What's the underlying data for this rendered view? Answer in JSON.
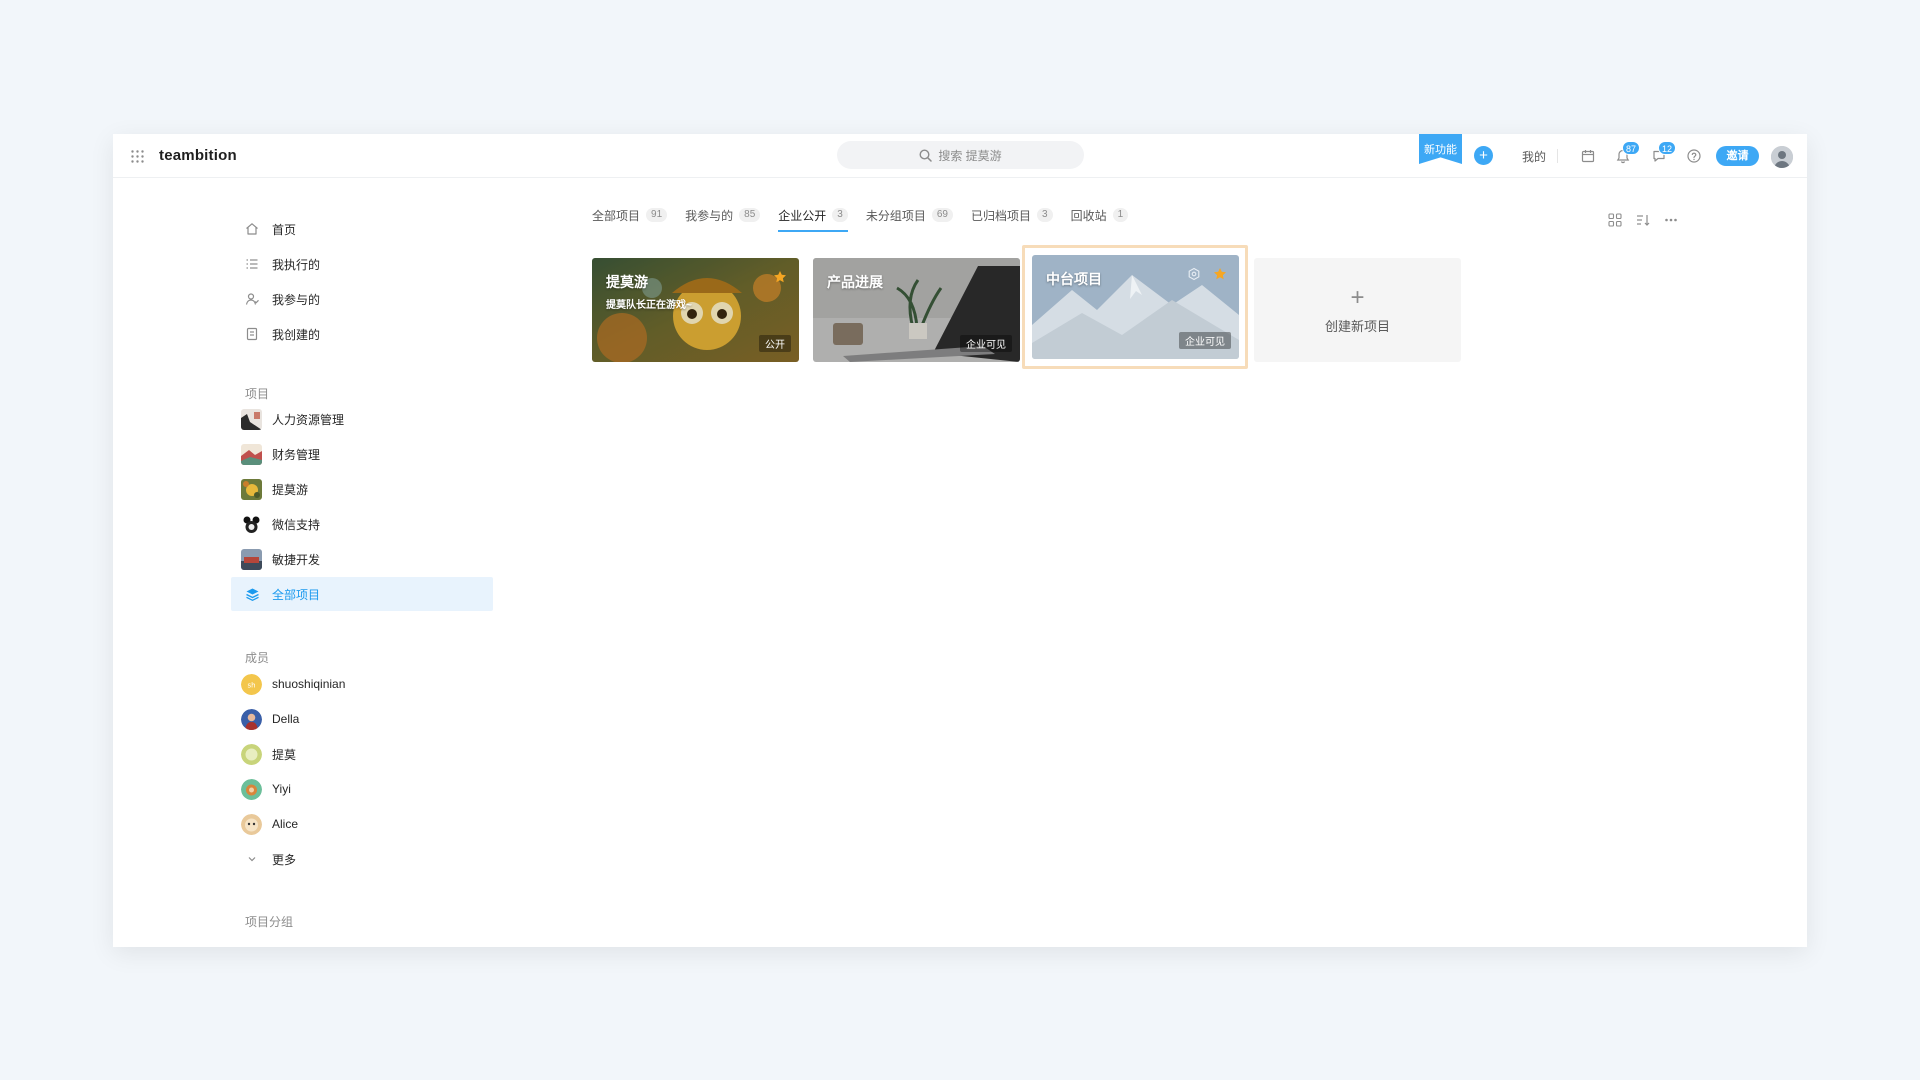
{
  "header": {
    "logo": "teambition",
    "search_placeholder": "搜索 提莫游",
    "new_feature": "新功能",
    "mine": "我的",
    "notifications_count": "87",
    "messages_count": "12",
    "invite": "邀请"
  },
  "sidebar": {
    "nav": [
      {
        "label": "首页",
        "icon": "home-icon"
      },
      {
        "label": "我执行的",
        "icon": "list-icon"
      },
      {
        "label": "我参与的",
        "icon": "users-icon"
      },
      {
        "label": "我创建的",
        "icon": "document-icon"
      }
    ],
    "projects_title": "项目",
    "projects": [
      {
        "label": "人力资源管理"
      },
      {
        "label": "财务管理"
      },
      {
        "label": "提莫游"
      },
      {
        "label": "微信支持"
      },
      {
        "label": "敏捷开发"
      },
      {
        "label": "全部项目",
        "active": true
      }
    ],
    "members_title": "成员",
    "members": [
      {
        "label": "shuoshiqinian"
      },
      {
        "label": "Della"
      },
      {
        "label": "提莫"
      },
      {
        "label": "Yiyi"
      },
      {
        "label": "Alice"
      }
    ],
    "more": "更多",
    "groups_title": "项目分组"
  },
  "tabs": [
    {
      "label": "全部项目",
      "count": "91"
    },
    {
      "label": "我参与的",
      "count": "85"
    },
    {
      "label": "企业公开",
      "count": "3",
      "active": true
    },
    {
      "label": "未分组项目",
      "count": "69"
    },
    {
      "label": "已归档项目",
      "count": "3"
    },
    {
      "label": "回收站",
      "count": "1"
    }
  ],
  "cards": [
    {
      "title": "提莫游",
      "desc": "提莫队长正在游戏~",
      "tag": "公开",
      "starred": true
    },
    {
      "title": "产品进展",
      "desc": "",
      "tag": "企业可见",
      "starred": false
    },
    {
      "title": "中台项目",
      "desc": "",
      "tag": "企业可见",
      "starred": true
    }
  ],
  "create_project": "创建新项目",
  "colors": {
    "accent": "#3da8f5",
    "star": "#f5a623",
    "highlight": "#f7dcb9"
  }
}
